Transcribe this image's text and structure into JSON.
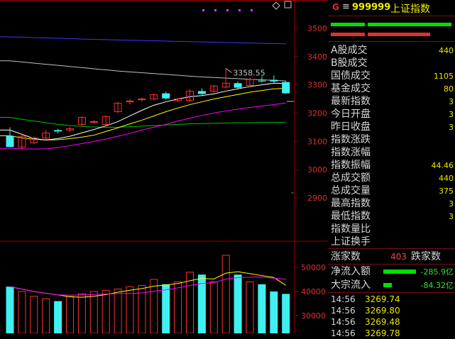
{
  "chart": {
    "price_ticks": [
      "3500",
      "3400",
      "3300",
      "3200",
      "3100",
      "3000",
      "2900"
    ],
    "vol_ticks": [
      "50000",
      "40000",
      "30000"
    ],
    "peak_label": "3358.55",
    "colors": {
      "up": "#ff3030",
      "down": "#40f0f0",
      "ma5": "#ffffff",
      "ma10": "#ffff00",
      "ma20": "#ff00ff",
      "ma60": "#00c000",
      "ma120": "#c0c0c0",
      "ma250": "#3838ff",
      "axis": "#a00000"
    }
  },
  "chart_data": {
    "type": "candlestick",
    "candles": [
      {
        "o": 3120,
        "h": 3150,
        "l": 3080,
        "c": 3080,
        "d": true
      },
      {
        "o": 3080,
        "h": 3125,
        "l": 3070,
        "c": 3118,
        "d": false
      },
      {
        "o": 3095,
        "h": 3118,
        "l": 3090,
        "c": 3112,
        "d": false
      },
      {
        "o": 3112,
        "h": 3140,
        "l": 3108,
        "c": 3130,
        "d": false
      },
      {
        "o": 3135,
        "h": 3145,
        "l": 3128,
        "c": 3140,
        "d": true
      },
      {
        "o": 3140,
        "h": 3150,
        "l": 3134,
        "c": 3145,
        "d": false
      },
      {
        "o": 3160,
        "h": 3188,
        "l": 3155,
        "c": 3185,
        "d": false
      },
      {
        "o": 3168,
        "h": 3175,
        "l": 3162,
        "c": 3170,
        "d": false
      },
      {
        "o": 3160,
        "h": 3192,
        "l": 3155,
        "c": 3188,
        "d": false
      },
      {
        "o": 3205,
        "h": 3240,
        "l": 3200,
        "c": 3235,
        "d": false
      },
      {
        "o": 3240,
        "h": 3250,
        "l": 3230,
        "c": 3243,
        "d": false
      },
      {
        "o": 3248,
        "h": 3255,
        "l": 3240,
        "c": 3250,
        "d": false
      },
      {
        "o": 3250,
        "h": 3268,
        "l": 3245,
        "c": 3265,
        "d": false
      },
      {
        "o": 3270,
        "h": 3276,
        "l": 3248,
        "c": 3252,
        "d": true
      },
      {
        "o": 3250,
        "h": 3254,
        "l": 3238,
        "c": 3244,
        "d": false
      },
      {
        "o": 3245,
        "h": 3285,
        "l": 3240,
        "c": 3278,
        "d": false
      },
      {
        "o": 3278,
        "h": 3288,
        "l": 3264,
        "c": 3268,
        "d": true
      },
      {
        "o": 3278,
        "h": 3300,
        "l": 3272,
        "c": 3296,
        "d": false
      },
      {
        "o": 3292,
        "h": 3358.55,
        "l": 3286,
        "c": 3306,
        "d": false
      },
      {
        "o": 3306,
        "h": 3312,
        "l": 3288,
        "c": 3290,
        "d": true
      },
      {
        "o": 3298,
        "h": 3325,
        "l": 3290,
        "c": 3319,
        "d": false
      },
      {
        "o": 3315,
        "h": 3330,
        "l": 3308,
        "c": 3312,
        "d": true
      },
      {
        "o": 3318,
        "h": 3334,
        "l": 3308,
        "c": 3312,
        "d": true
      },
      {
        "o": 3310,
        "h": 3314,
        "l": 3268,
        "c": 3270,
        "d": true
      }
    ],
    "volumes": [
      42000,
      40000,
      38000,
      37000,
      36000,
      38000,
      39000,
      40000,
      40500,
      41000,
      42000,
      42500,
      45000,
      43000,
      44000,
      48000,
      47000,
      44000,
      55000,
      47000,
      44000,
      43000,
      40000,
      39000
    ],
    "ma5": [
      3140,
      3125,
      3110,
      3105,
      3110,
      3118,
      3130,
      3142,
      3155,
      3170,
      3190,
      3210,
      3228,
      3240,
      3250,
      3258,
      3262,
      3268,
      3278,
      3286,
      3294,
      3300,
      3306,
      3305
    ],
    "ma10": [
      3120,
      3112,
      3108,
      3105,
      3106,
      3110,
      3115,
      3122,
      3135,
      3148,
      3162,
      3175,
      3190,
      3205,
      3218,
      3230,
      3240,
      3250,
      3258,
      3266,
      3274,
      3280,
      3286,
      3288
    ],
    "ma20": [
      3075,
      3074,
      3073,
      3074,
      3078,
      3085,
      3092,
      3100,
      3108,
      3118,
      3128,
      3140,
      3150,
      3160,
      3172,
      3182,
      3192,
      3200,
      3208,
      3214,
      3220,
      3225,
      3230,
      3236
    ],
    "ma60": [
      3185,
      3178,
      3172,
      3166,
      3160,
      3156,
      3153,
      3151,
      3150,
      3150,
      3152,
      3154,
      3156,
      3158,
      3160,
      3162,
      3163,
      3164,
      3165,
      3166,
      3166,
      3167,
      3167,
      3168
    ],
    "ma120": [
      3385,
      3381,
      3377,
      3373,
      3369,
      3365,
      3361,
      3357,
      3353,
      3349,
      3346,
      3343,
      3340,
      3337,
      3334,
      3331,
      3328,
      3326,
      3324,
      3322,
      3320,
      3318,
      3316,
      3314
    ],
    "ma250": [
      3470,
      3469,
      3467,
      3466,
      3465,
      3464,
      3462,
      3461,
      3460,
      3459,
      3458,
      3457,
      3456,
      3455,
      3454,
      3453,
      3452,
      3451,
      3450,
      3449,
      3448,
      3447,
      3446,
      3445
    ]
  },
  "panel": {
    "g": "G",
    "menu": "≡",
    "code": "999999",
    "name": "上证指数",
    "stats": [
      {
        "label": "A股成交",
        "value": "440"
      },
      {
        "label": "B股成交",
        "value": ""
      },
      {
        "label": "国债成交",
        "value": "1105"
      },
      {
        "label": "基金成交",
        "value": "80"
      },
      {
        "label": "最新指数",
        "value": "3"
      },
      {
        "label": "今日开盘",
        "value": "3"
      },
      {
        "label": "昨日收盘",
        "value": "3"
      },
      {
        "label": "指数涨跌",
        "value": ""
      },
      {
        "label": "指数涨幅",
        "value": ""
      },
      {
        "label": "指数振幅",
        "value": "44.46"
      },
      {
        "label": "总成交额",
        "value": "440"
      },
      {
        "label": "总成交量",
        "value": "375"
      },
      {
        "label": "最高指数",
        "value": "3"
      },
      {
        "label": "最低指数",
        "value": "3"
      },
      {
        "label": "指数量比",
        "value": ""
      },
      {
        "label": "上证换手",
        "value": ""
      }
    ],
    "up_label": "涨家数",
    "up_count": "403",
    "down_label": "跌家数",
    "net_inflow_label": "净流入额",
    "net_inflow_value": "-285.9亿",
    "block_inflow_label": "大宗流入",
    "block_inflow_value": "-84.32亿",
    "ticks": [
      {
        "time": "14:56",
        "price": "3269.74"
      },
      {
        "time": "14:56",
        "price": "3269.80"
      },
      {
        "time": "14:56",
        "price": "3269.48"
      },
      {
        "time": "14:56",
        "price": "3269.78"
      }
    ]
  }
}
